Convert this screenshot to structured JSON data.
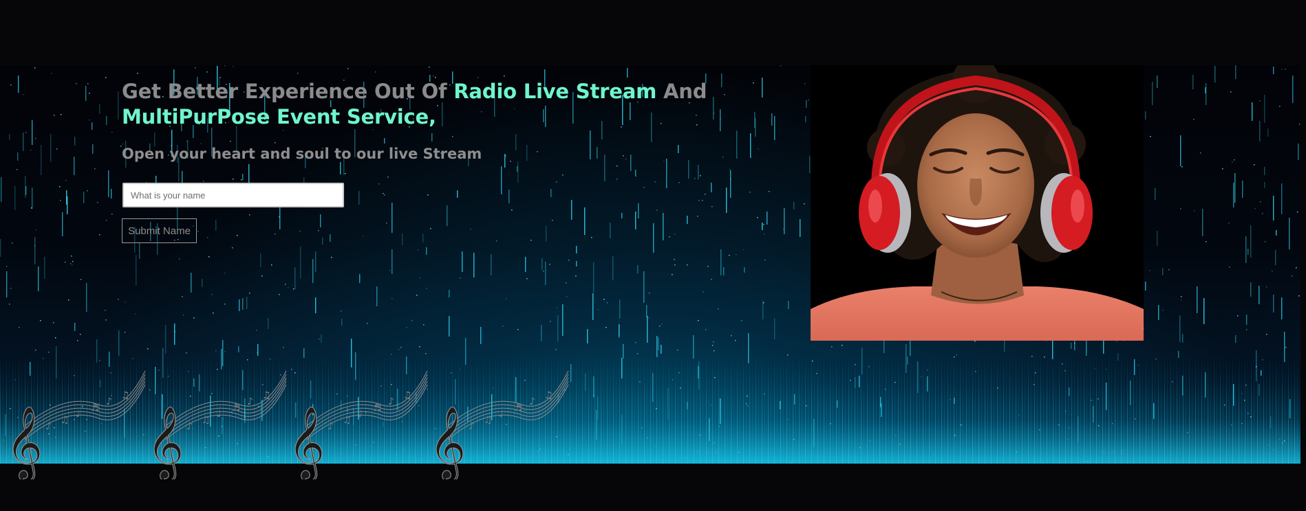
{
  "hero": {
    "headline_part1": "Get Better Experience Out Of ",
    "headline_accent1": "Radio Live Stream",
    "headline_part2": " And",
    "headline_accent2": "MultiPurPose Event Service,",
    "subheadline": "Open your heart and soul to our live Stream"
  },
  "form": {
    "name_placeholder": "What is your name",
    "submit_label": "Submit Name"
  },
  "images": {
    "portrait_icon": "woman-with-red-headphones-icon",
    "music_notes_icon": "treble-clef-music-notes-icon"
  },
  "colors": {
    "accent": "#6ff5cd",
    "muted_text": "#8b8b8b",
    "page_background": "#060608",
    "rain_glow": "#2fd7f2"
  }
}
